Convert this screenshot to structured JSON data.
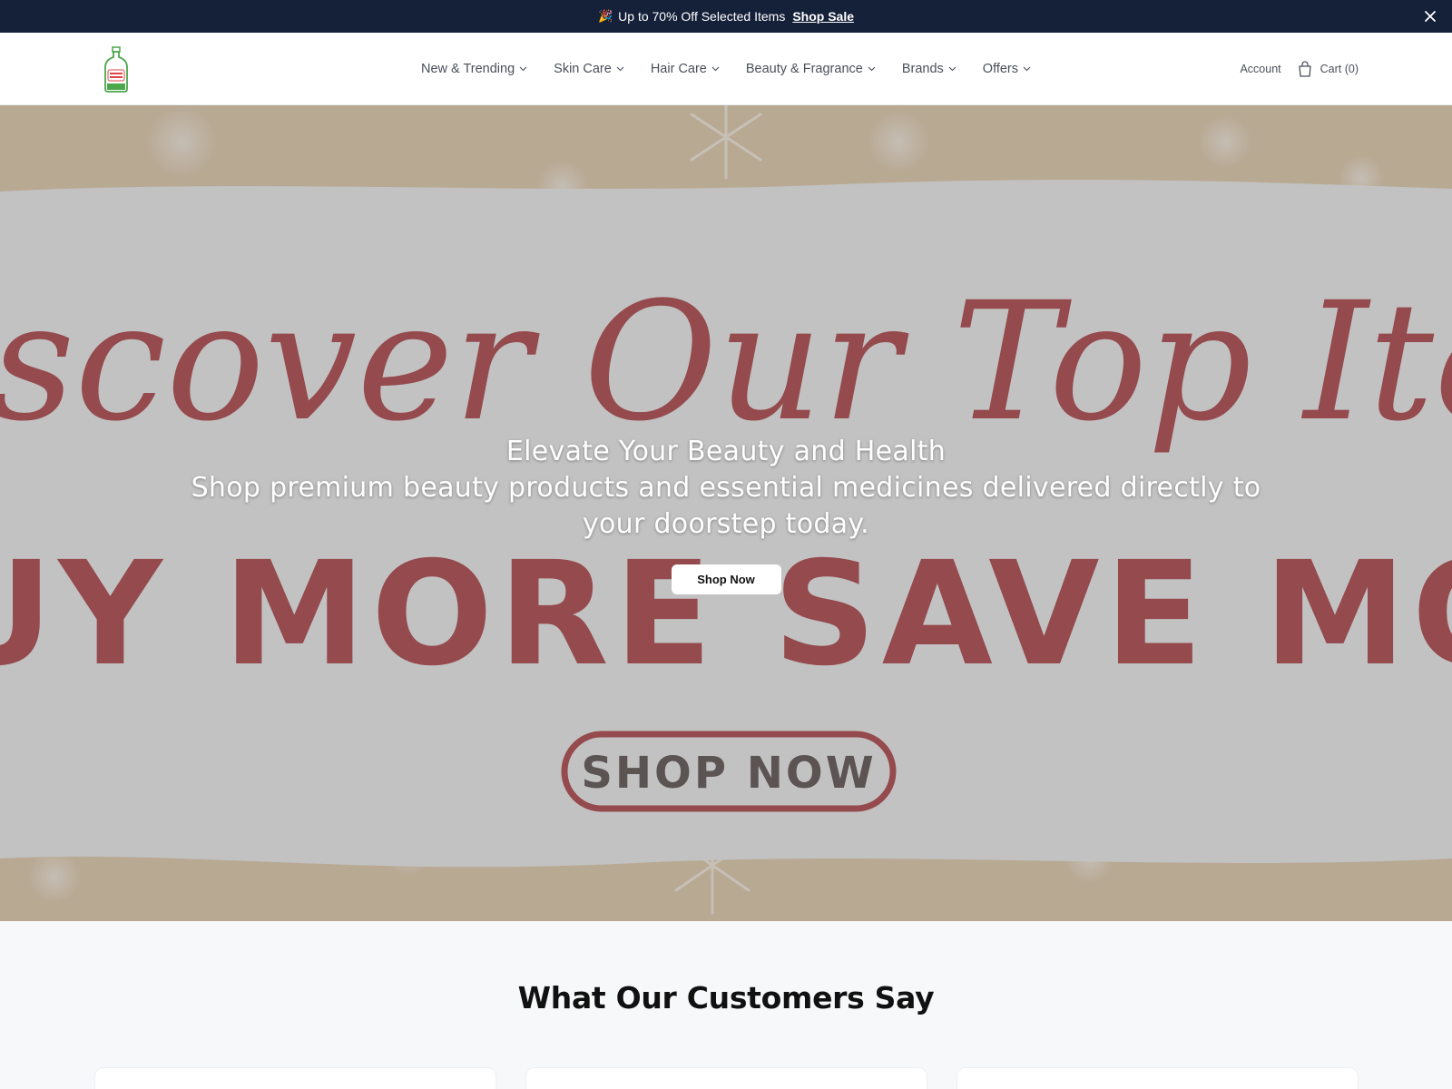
{
  "announcement": {
    "emoji": "🎉",
    "message": "Up to 70% Off Selected Items",
    "link_label": "Shop Sale"
  },
  "header": {
    "logo_icon": "bottle-logo-icon",
    "nav": [
      {
        "label": "New & Trending"
      },
      {
        "label": "Skin Care"
      },
      {
        "label": "Hair Care"
      },
      {
        "label": "Beauty & Fragrance"
      },
      {
        "label": "Brands"
      },
      {
        "label": "Offers"
      }
    ],
    "account_label": "Account",
    "cart_label": "Cart (0)"
  },
  "hero": {
    "banner_script_text": "scover  Our  Top  Ite",
    "banner_block_text": "UY MORE SAVE MO",
    "banner_button_text": "SHOP NOW",
    "title": "Elevate Your Beauty and Health",
    "subtitle": "Shop premium beauty products and essential medicines delivered directly to your doorstep today.",
    "cta_label": "Shop Now"
  },
  "testimonials": {
    "title": "What Our Customers Say"
  },
  "colors": {
    "announcement_bg": "#152039",
    "banner_red": "#9b1b20",
    "banner_beige": "#c9ab88"
  }
}
